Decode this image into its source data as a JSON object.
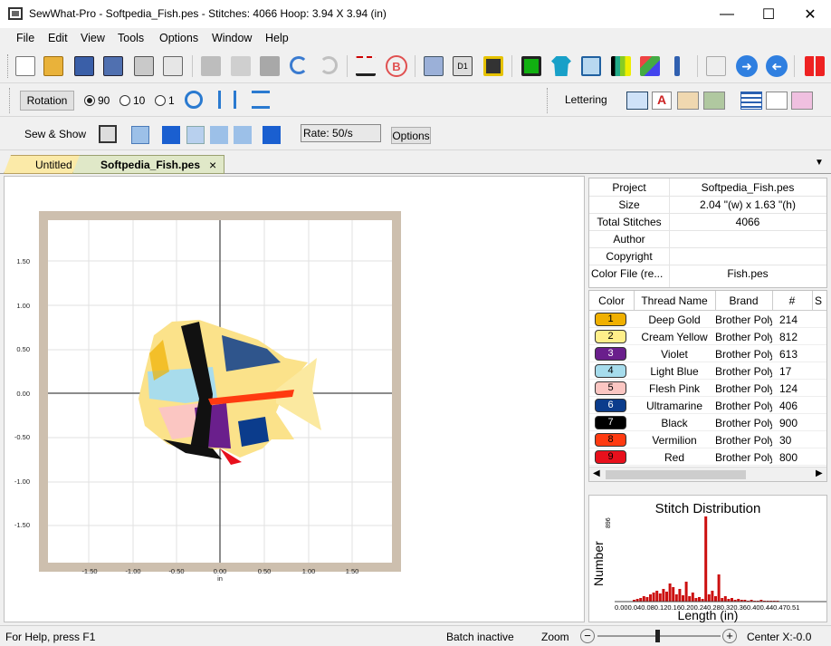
{
  "window": {
    "title": "SewWhat-Pro - Softpedia_Fish.pes - Stitches: 4066  Hoop: 3.94 X 3.94 (in)",
    "minimize_glyph": "—",
    "maximize_glyph": "☐",
    "close_glyph": "✕"
  },
  "menu": [
    "File",
    "Edit",
    "View",
    "Tools",
    "Options",
    "Window",
    "Help"
  ],
  "toolbar_icons": [
    "new-file",
    "open-folder",
    "save",
    "save-as",
    "print",
    "print-preview",
    "cut",
    "copy",
    "paste",
    "undo",
    "redo",
    "stitch-add",
    "brother-logo",
    "copy-pages",
    "design-d1",
    "save-card",
    "green-square",
    "shirt",
    "hoop",
    "color-bars",
    "thread",
    "needle",
    "disabled-box",
    "arrow-right",
    "arrow-left",
    "split-view"
  ],
  "rotation": {
    "button_label": "Rotation",
    "opt_90": "90",
    "opt_10": "10",
    "opt_1": "1",
    "selected": "90"
  },
  "lettering": {
    "label": "Lettering"
  },
  "sewshow": {
    "label": "Sew & Show",
    "rate": "Rate:  50/s",
    "options_label": "Options"
  },
  "tabs": {
    "untitled": "Untitled",
    "active": "Softpedia_Fish.pes",
    "close": "×",
    "dropdown": "▼"
  },
  "plot": {
    "y_ticks": [
      "1.50",
      "1.00",
      "0.50",
      "0.00",
      "-0.50",
      "-1.00",
      "-1.50"
    ],
    "x_ticks": [
      "-1.50",
      "-1.00",
      "-0.50",
      "0.00",
      "0.50",
      "1.00",
      "1.50"
    ],
    "x_unit": "in"
  },
  "info": {
    "rows": [
      [
        "Project",
        "Softpedia_Fish.pes"
      ],
      [
        "Size",
        "2.04 \"(w) x 1.63 \"(h)"
      ],
      [
        "Total Stitches",
        "4066"
      ],
      [
        "Author",
        ""
      ],
      [
        "Copyright",
        ""
      ],
      [
        "Color File (re...",
        "Fish.pes"
      ]
    ]
  },
  "threads": {
    "headers": [
      "Color",
      "Thread Name",
      "Brand",
      "#",
      "S"
    ],
    "rows": [
      {
        "num": "1",
        "name": "Deep Gold",
        "brand": "Brother Poly",
        "count": "214",
        "color": "#f0b000"
      },
      {
        "num": "2",
        "name": "Cream Yellow",
        "brand": "Brother Poly",
        "count": "812",
        "color": "#ffef8a"
      },
      {
        "num": "3",
        "name": "Violet",
        "brand": "Brother Poly",
        "count": "613",
        "color": "#6a1f8c"
      },
      {
        "num": "4",
        "name": "Light Blue",
        "brand": "Brother Poly",
        "count": "17",
        "color": "#a6dcec"
      },
      {
        "num": "5",
        "name": "Flesh Pink",
        "brand": "Brother Poly",
        "count": "124",
        "color": "#fbc6c2"
      },
      {
        "num": "6",
        "name": "Ultramarine",
        "brand": "Brother Poly",
        "count": "406",
        "color": "#0b3c8c"
      },
      {
        "num": "7",
        "name": "Black",
        "brand": "Brother Poly",
        "count": "900",
        "color": "#000000"
      },
      {
        "num": "8",
        "name": "Vermilion",
        "brand": "Brother Poly",
        "count": "30",
        "color": "#ff3a10"
      },
      {
        "num": "9",
        "name": "Red",
        "brand": "Brother Poly",
        "count": "800",
        "color": "#e8101c"
      }
    ]
  },
  "distribution": {
    "title": "Stitch Distribution",
    "ylabel": "Number",
    "ymax": "896",
    "xticks": "0.000.040.080.120.160.200.240.280.320.360.400.440.470.51",
    "xlabel": "Length (in)"
  },
  "status": {
    "help": "For Help, press F1",
    "batch": "Batch inactive",
    "zoom": "Zoom",
    "minus": "−",
    "plus": "+",
    "center": "Center X:-0.0"
  }
}
